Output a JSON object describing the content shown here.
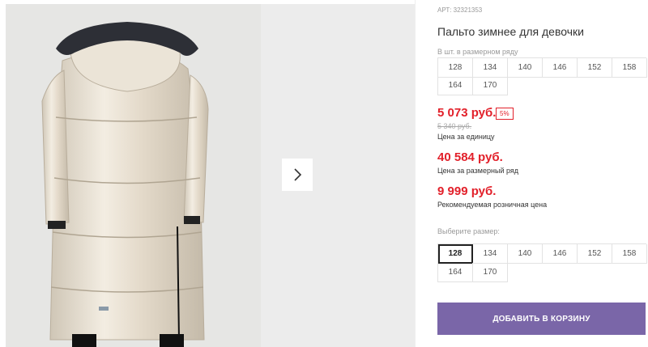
{
  "product": {
    "sku_label": "АРТ:",
    "sku_value": "32321353",
    "title": "Пальто зимнее для девочки"
  },
  "pack_sizes": {
    "caption": "В шт. в размерном ряду",
    "row1": [
      "128",
      "134",
      "140",
      "146",
      "152",
      "158"
    ],
    "row2": [
      "164",
      "170"
    ]
  },
  "pricing": {
    "price": "5 073 руб.",
    "discount": "5%",
    "old_price": "5 340 руб.",
    "unit_note": "Цена за единицу",
    "pack_price": "40 584 руб.",
    "pack_note": "Цена за размерный ряд",
    "retail_price": "9 999 руб.",
    "retail_note": "Рекомендуемая розничная цена",
    "accent_color": "#e2202a"
  },
  "size_select": {
    "caption": "Выберите размер:",
    "row1": [
      "128",
      "134",
      "140",
      "146",
      "152",
      "158"
    ],
    "row2": [
      "164",
      "170"
    ],
    "selected": "128"
  },
  "cart": {
    "add_label": "ДОБАВИТЬ В КОРЗИНУ",
    "button_color": "#7a66a8"
  },
  "gallery": {
    "next_icon": "chevron-right-icon"
  }
}
